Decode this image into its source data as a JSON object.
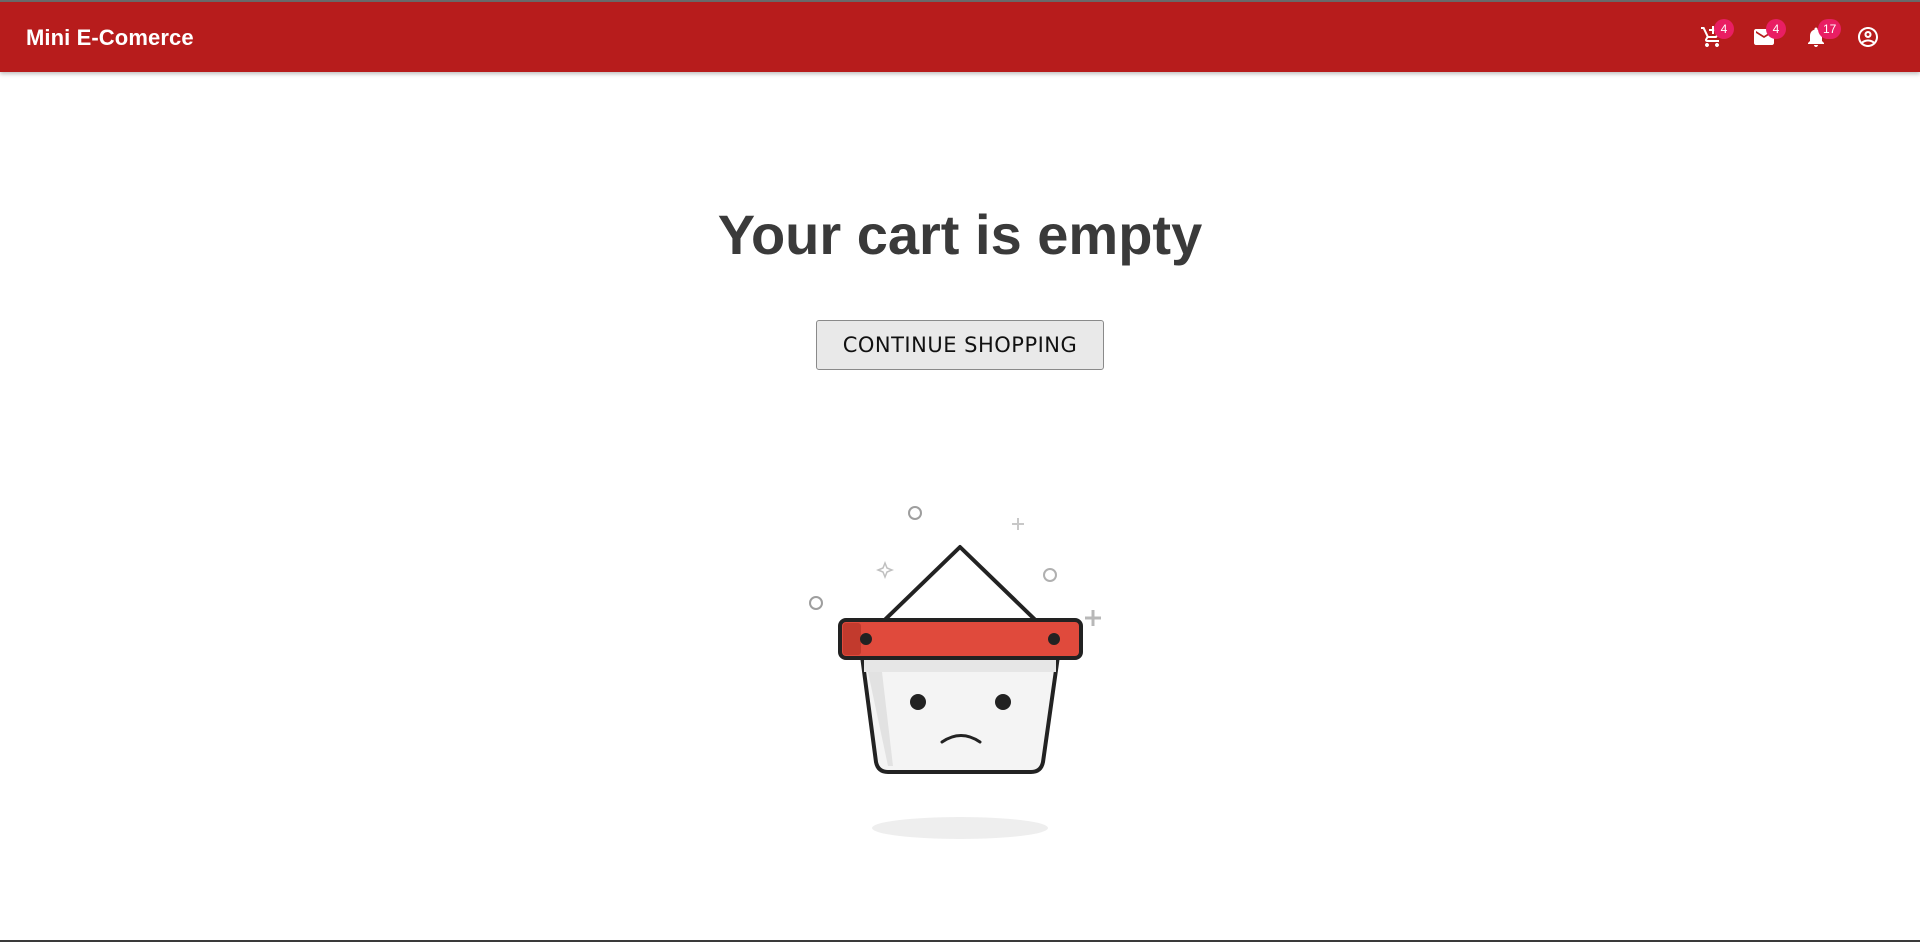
{
  "header": {
    "brand": "Mini E-Comerce",
    "actions": [
      {
        "icon": "cart-icon",
        "badge": "4"
      },
      {
        "icon": "mail-icon",
        "badge": "4"
      },
      {
        "icon": "bell-icon",
        "badge": "17"
      },
      {
        "icon": "account-circle-icon",
        "badge": null
      }
    ]
  },
  "main": {
    "title": "Your cart is empty",
    "continue_label": "CONTINUE SHOPPING"
  },
  "colors": {
    "appbar": "#b71c1c",
    "badge": "#e91e63",
    "basket_band": "#e04a3c"
  }
}
